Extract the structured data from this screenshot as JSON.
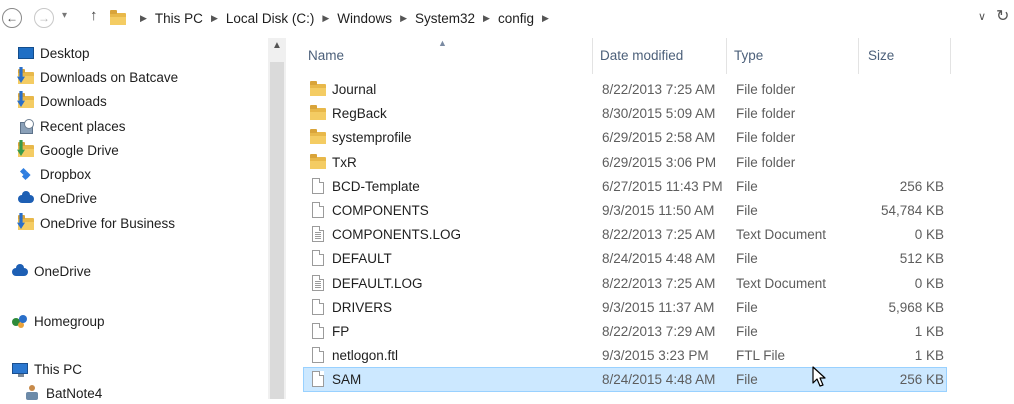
{
  "address_bar": {
    "crumbs": [
      "This PC",
      "Local Disk (C:)",
      "Windows",
      "System32",
      "config"
    ]
  },
  "nav_pane": {
    "items": [
      {
        "label": "Desktop",
        "icon": "desktop-icon"
      },
      {
        "label": "Downloads on Batcave",
        "icon": "folder-download-icon"
      },
      {
        "label": "Downloads",
        "icon": "folder-download-icon"
      },
      {
        "label": "Recent places",
        "icon": "recent-places-icon"
      },
      {
        "label": "Google Drive",
        "icon": "folder-icon"
      },
      {
        "label": "Dropbox",
        "icon": "dropbox-icon"
      },
      {
        "label": "OneDrive",
        "icon": "onedrive-icon"
      },
      {
        "label": "OneDrive for Business",
        "icon": "folder-icon"
      },
      {
        "label": "OneDrive",
        "icon": "onedrive-icon"
      },
      {
        "label": "Homegroup",
        "icon": "homegroup-icon"
      },
      {
        "label": "This PC",
        "icon": "this-pc-icon"
      },
      {
        "label": "BatNote4",
        "icon": "user-computer-icon"
      }
    ]
  },
  "file_list": {
    "columns": {
      "name": "Name",
      "date": "Date modified",
      "type": "Type",
      "size": "Size"
    },
    "rows": [
      {
        "name": "Journal",
        "date": "8/22/2013 7:25 AM",
        "type": "File folder",
        "size": "",
        "kind": "folder"
      },
      {
        "name": "RegBack",
        "date": "8/30/2015 5:09 AM",
        "type": "File folder",
        "size": "",
        "kind": "folder"
      },
      {
        "name": "systemprofile",
        "date": "6/29/2015 2:58 AM",
        "type": "File folder",
        "size": "",
        "kind": "folder"
      },
      {
        "name": "TxR",
        "date": "6/29/2015 3:06 PM",
        "type": "File folder",
        "size": "",
        "kind": "folder"
      },
      {
        "name": "BCD-Template",
        "date": "6/27/2015 11:43 PM",
        "type": "File",
        "size": "256 KB",
        "kind": "file"
      },
      {
        "name": "COMPONENTS",
        "date": "9/3/2015 11:50 AM",
        "type": "File",
        "size": "54,784 KB",
        "kind": "file"
      },
      {
        "name": "COMPONENTS.LOG",
        "date": "8/22/2013 7:25 AM",
        "type": "Text Document",
        "size": "0 KB",
        "kind": "text"
      },
      {
        "name": "DEFAULT",
        "date": "8/24/2015 4:48 AM",
        "type": "File",
        "size": "512 KB",
        "kind": "file"
      },
      {
        "name": "DEFAULT.LOG",
        "date": "8/22/2013 7:25 AM",
        "type": "Text Document",
        "size": "0 KB",
        "kind": "text"
      },
      {
        "name": "DRIVERS",
        "date": "9/3/2015 11:37 AM",
        "type": "File",
        "size": "5,968 KB",
        "kind": "file"
      },
      {
        "name": "FP",
        "date": "8/22/2013 7:29 AM",
        "type": "File",
        "size": "1 KB",
        "kind": "file"
      },
      {
        "name": "netlogon.ftl",
        "date": "9/3/2015 3:23 PM",
        "type": "FTL File",
        "size": "1 KB",
        "kind": "file"
      },
      {
        "name": "SAM",
        "date": "8/24/2015 4:48 AM",
        "type": "File",
        "size": "256 KB",
        "kind": "file",
        "selected": true
      }
    ]
  },
  "colors": {
    "selection_bg": "#cce8ff",
    "selection_border": "#99d1ff",
    "header_text": "#4c607a",
    "folder": "#e8b84a"
  }
}
